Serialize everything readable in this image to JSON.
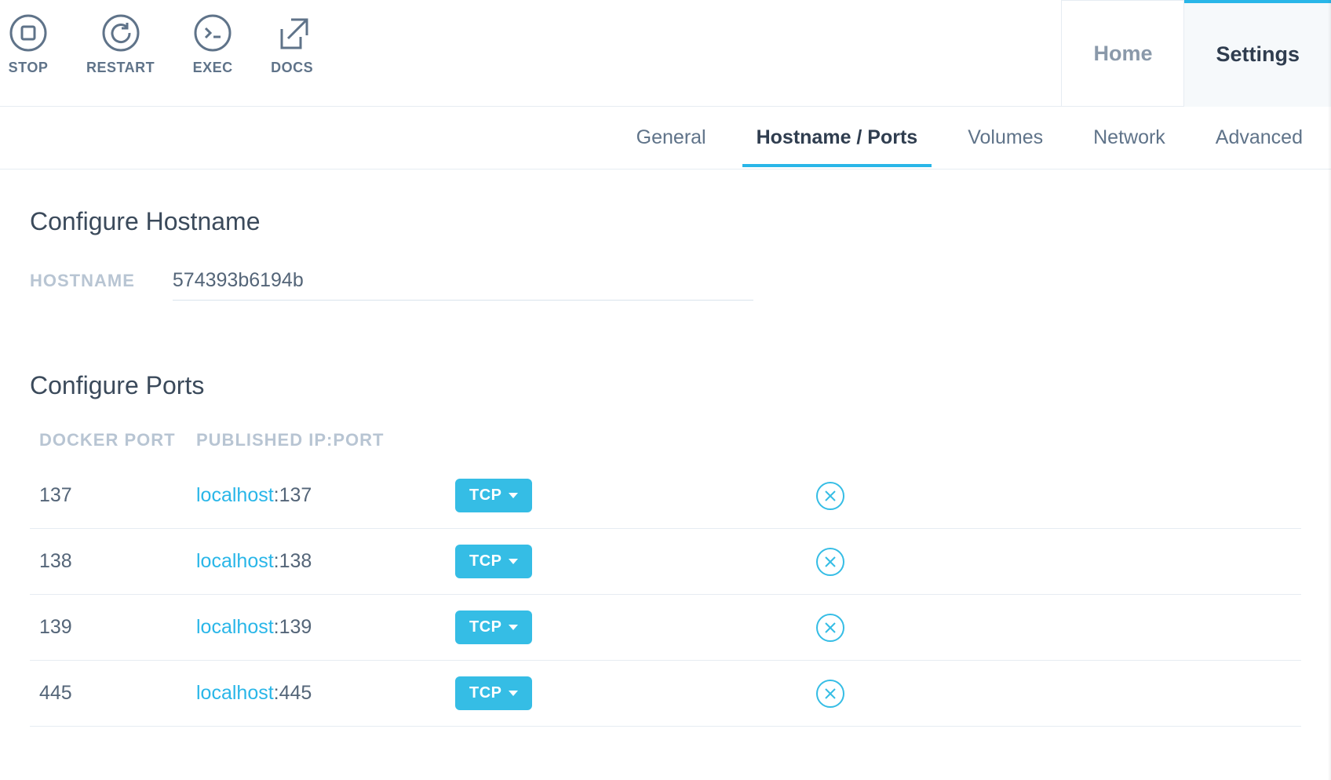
{
  "toolbar": {
    "stop": {
      "label": "STOP"
    },
    "restart": {
      "label": "RESTART"
    },
    "exec": {
      "label": "EXEC"
    },
    "docs": {
      "label": "DOCS"
    }
  },
  "topnav": {
    "home": "Home",
    "settings": "Settings"
  },
  "subtabs": {
    "general": "General",
    "hostname": "Hostname / Ports",
    "volumes": "Volumes",
    "network": "Network",
    "advanced": "Advanced"
  },
  "sections": {
    "configure_hostname": "Configure Hostname",
    "configure_ports": "Configure Ports"
  },
  "hostname": {
    "label": "HOSTNAME",
    "value": "574393b6194b"
  },
  "ports_table": {
    "headers": {
      "docker_port": "DOCKER PORT",
      "published": "PUBLISHED IP:PORT"
    },
    "rows": [
      {
        "docker_port": "137",
        "host": "localhost",
        "host_port": "137",
        "protocol": "TCP"
      },
      {
        "docker_port": "138",
        "host": "localhost",
        "host_port": "138",
        "protocol": "TCP"
      },
      {
        "docker_port": "139",
        "host": "localhost",
        "host_port": "139",
        "protocol": "TCP"
      },
      {
        "docker_port": "445",
        "host": "localhost",
        "host_port": "445",
        "protocol": "TCP"
      }
    ]
  }
}
